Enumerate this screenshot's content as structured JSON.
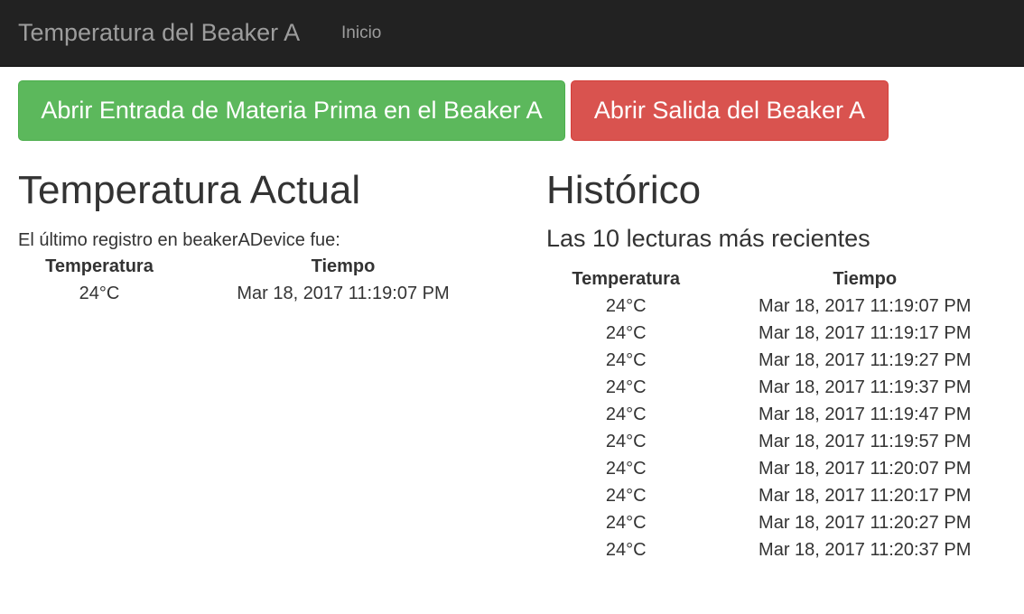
{
  "navbar": {
    "brand": "Temperatura del Beaker A",
    "link_home": "Inicio"
  },
  "buttons": {
    "open_input": "Abrir Entrada de Materia Prima en el Beaker A",
    "open_output": "Abrir Salida del Beaker A"
  },
  "colors": {
    "navbar_bg": "#222222",
    "success": "#5cb85c",
    "danger": "#d9534f"
  },
  "current": {
    "title": "Temperatura Actual",
    "intro": "El último registro en beakerADevice fue:",
    "headers": [
      "Temperatura",
      "Tiempo"
    ],
    "row": [
      "24°C",
      "Mar 18, 2017 11:19:07 PM"
    ]
  },
  "history": {
    "title": "Histórico",
    "subtitle": "Las 10 lecturas más recientes",
    "headers": [
      "Temperatura",
      "Tiempo"
    ],
    "rows": [
      [
        "24°C",
        "Mar 18, 2017 11:19:07 PM"
      ],
      [
        "24°C",
        "Mar 18, 2017 11:19:17 PM"
      ],
      [
        "24°C",
        "Mar 18, 2017 11:19:27 PM"
      ],
      [
        "24°C",
        "Mar 18, 2017 11:19:37 PM"
      ],
      [
        "24°C",
        "Mar 18, 2017 11:19:47 PM"
      ],
      [
        "24°C",
        "Mar 18, 2017 11:19:57 PM"
      ],
      [
        "24°C",
        "Mar 18, 2017 11:20:07 PM"
      ],
      [
        "24°C",
        "Mar 18, 2017 11:20:17 PM"
      ],
      [
        "24°C",
        "Mar 18, 2017 11:20:27 PM"
      ],
      [
        "24°C",
        "Mar 18, 2017 11:20:37 PM"
      ]
    ]
  }
}
